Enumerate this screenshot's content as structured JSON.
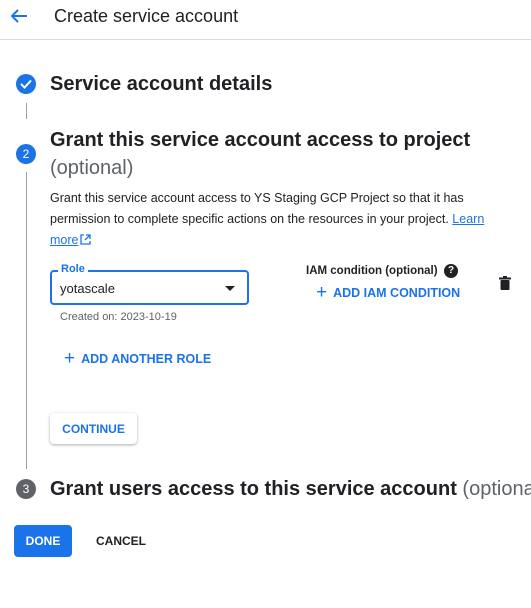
{
  "header": {
    "title": "Create service account",
    "back_icon": "arrow-back-icon"
  },
  "steps": [
    {
      "number": "1",
      "title": "Service account details",
      "status": "done"
    },
    {
      "number": "2",
      "title": "Grant this service account access to project",
      "optional": "(optional)",
      "status": "active",
      "description": "Grant this service account access to YS Staging GCP Project so that it has permission to complete specific actions on the resources in your project.",
      "learn_more_line1": "Learn",
      "learn_more_line2": "more",
      "role": {
        "label": "Role",
        "value": "yotascale",
        "created": "Created on: 2023-10-19"
      },
      "iam_condition": {
        "label": "IAM condition (optional)",
        "help_glyph": "?",
        "add_label": "ADD IAM CONDITION"
      },
      "add_role_label": "ADD ANOTHER ROLE",
      "continue_label": "CONTINUE"
    },
    {
      "number": "3",
      "title": "Grant users access to this service account",
      "optional": "(optional)",
      "status": "inactive"
    }
  ],
  "footer": {
    "done_label": "DONE",
    "cancel_label": "CANCEL"
  },
  "colors": {
    "primary": "#1a73e8",
    "inactive": "#5f6368",
    "text": "#202124"
  }
}
